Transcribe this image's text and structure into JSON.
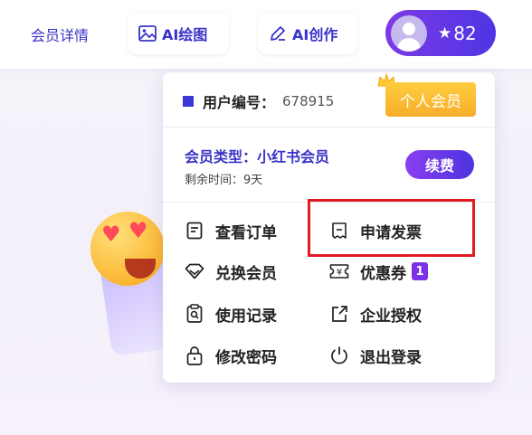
{
  "nav": {
    "member_details": "会员详情",
    "ai_draw": "AI绘图",
    "ai_create": "AI创作"
  },
  "user": {
    "points": "82"
  },
  "panel": {
    "user_id_label": "用户编号：",
    "user_id_value": "678915",
    "personal_badge": "个人会员",
    "member_type": "会员类型：小红书会员",
    "remaining_time": "剩余时间：9天",
    "renew": "续费",
    "menu": {
      "orders": "查看订单",
      "invoice": "申请发票",
      "redeem": "兑换会员",
      "coupons": "优惠券",
      "coupon_count": "1",
      "usage": "使用记录",
      "enterprise": "企业授权",
      "password": "修改密码",
      "logout": "退出登录"
    }
  },
  "colors": {
    "brand": "#3a33c8",
    "accent_purple": "#7b31e8",
    "gold": "#f7ad2a",
    "highlight": "#e11b22"
  }
}
